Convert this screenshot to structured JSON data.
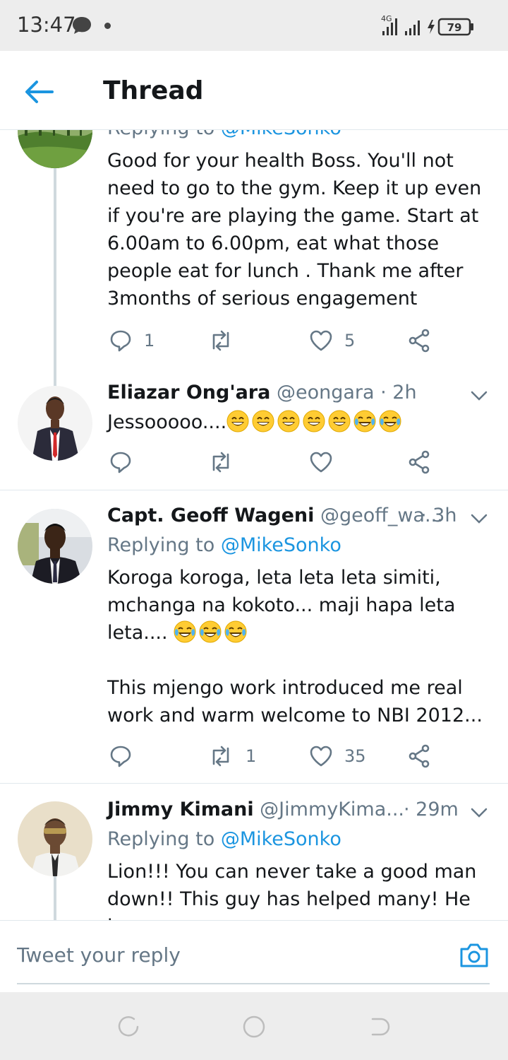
{
  "status_bar": {
    "time": "13:47",
    "network": "4G",
    "battery": "79"
  },
  "header": {
    "title": "Thread"
  },
  "tweets": [
    {
      "replying_label": "Replying to ",
      "replying_handle": "@MikeSonko",
      "text": "Good for your health Boss. You'll not need to go to the gym. Keep it up even if you're are playing the game. Start at 6.00am to 6.00pm, eat what those people eat for lunch . Thank me after 3months of serious engagement",
      "reply_count": "1",
      "retweet_count": "",
      "like_count": "5"
    },
    {
      "name": "Eliazar Ong'ara",
      "handle": "@eongara",
      "time": "· 2h",
      "text": "Jessooooo....",
      "emoji": [
        "grin",
        "grin",
        "grin",
        "grin",
        "grin",
        "tears",
        "tears"
      ],
      "reply_count": "",
      "retweet_count": "",
      "like_count": ""
    },
    {
      "name": "Capt. Geoff Wageni",
      "handle": "@geoff_wa...",
      "time": "· 3h",
      "replying_label": "Replying to ",
      "replying_handle": "@MikeSonko",
      "text1": "Koroga koroga, leta leta leta simiti, mchanga na kokoto... maji hapa leta leta....",
      "emoji": [
        "tears",
        "tears",
        "tears"
      ],
      "text2": "This mjengo work introduced me real work and warm welcome to NBI 2012...",
      "reply_count": "",
      "retweet_count": "1",
      "like_count": "35"
    },
    {
      "name": "Jimmy Kimani",
      "handle": "@JimmyKima...",
      "time": "· 29m",
      "replying_label": "Replying to ",
      "replying_handle": "@MikeSonko",
      "text": "Lion!!! You can never take a good man down!! This guy has helped many! He is"
    }
  ],
  "reply_bar": {
    "placeholder": "Tweet your reply"
  },
  "colors": {
    "accent": "#1b95e0",
    "secondary_text": "#657786",
    "border": "#e1e8ed"
  },
  "icons": {
    "back": "arrow-left-icon",
    "reply": "reply-bubble-icon",
    "retweet": "retweet-icon",
    "like": "heart-icon",
    "share": "share-icon",
    "caret": "chevron-down-icon",
    "camera": "camera-icon"
  }
}
